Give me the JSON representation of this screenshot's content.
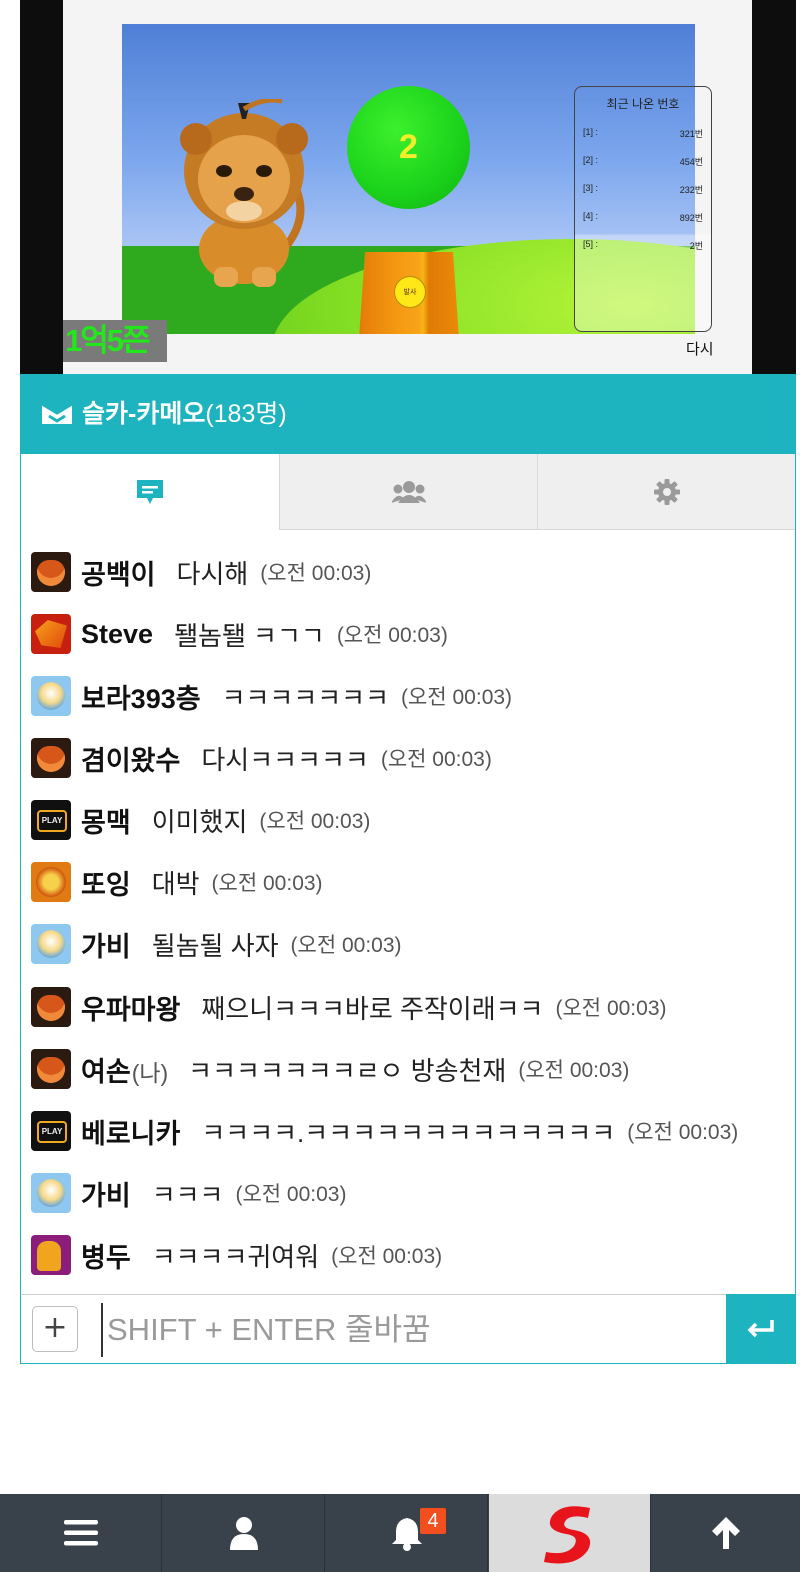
{
  "video": {
    "ball_number": "2",
    "cup_button": "발사",
    "since_label": "1억5쯘",
    "again_label": "다시",
    "recent": {
      "title": "최근 나온 번호",
      "rows": [
        {
          "key": "[1] :",
          "value": "321번"
        },
        {
          "key": "[2] :",
          "value": "454번"
        },
        {
          "key": "[3] :",
          "value": "232번"
        },
        {
          "key": "[4] :",
          "value": "892번"
        },
        {
          "key": "[5] :",
          "value": "2번"
        }
      ]
    }
  },
  "chat": {
    "title": "슬카-카메오",
    "count": "(183명)",
    "tabs": [
      {
        "name": "chat",
        "icon": "chat-bubble-icon"
      },
      {
        "name": "users",
        "icon": "users-icon"
      },
      {
        "name": "settings",
        "icon": "gear-icon"
      }
    ],
    "messages": [
      {
        "nick": "공백이",
        "tag": "",
        "text": "다시해",
        "time": "(오전 00:03)",
        "avatar": "av-dog"
      },
      {
        "nick": "Steve",
        "tag": "",
        "text": "됄놈됄 ㅋㄱㄱ",
        "time": "(오전 00:03)",
        "avatar": "av-dragon"
      },
      {
        "nick": "보라393층",
        "tag": "",
        "text": "ㅋㅋㅋㅋㅋㅋㅋ",
        "time": "(오전 00:03)",
        "avatar": "av-armor"
      },
      {
        "nick": "겸이왔수",
        "tag": "",
        "text": "다시ㅋㅋㅋㅋㅋ",
        "time": "(오전 00:03)",
        "avatar": "av-dog"
      },
      {
        "nick": "몽맥",
        "tag": "",
        "text": "이미했지",
        "time": "(오전 00:03)",
        "avatar": "av-play"
      },
      {
        "nick": "또잉",
        "tag": "",
        "text": "대박",
        "time": "(오전 00:03)",
        "avatar": "av-lion"
      },
      {
        "nick": "가비",
        "tag": "",
        "text": "될놈될 사자",
        "time": "(오전 00:03)",
        "avatar": "av-armor"
      },
      {
        "nick": "우파마왕",
        "tag": "",
        "text": "째으니ㅋㅋㅋ바로 주작이래ㅋㅋ",
        "time": "(오전 00:03)",
        "avatar": "av-dog"
      },
      {
        "nick": "여손",
        "tag": "(나)",
        "text": "ㅋㅋㅋㅋㅋㅋㅋㄹㅇ 방송천재",
        "time": "(오전 00:03)",
        "avatar": "av-dog"
      },
      {
        "nick": "베로니카",
        "tag": "",
        "text": "ㅋㅋㅋㅋ.ㅋㅋㅋㅋㅋㅋㅋㅋㅋㅋㅋㅋㅋ",
        "time": "(오전 00:03)",
        "avatar": "av-play"
      },
      {
        "nick": "가비",
        "tag": "",
        "text": "ㅋㅋㅋ",
        "time": "(오전 00:03)",
        "avatar": "av-armor"
      },
      {
        "nick": "병두",
        "tag": "",
        "text": "ㅋㅋㅋㅋ귀여워",
        "time": "(오전 00:03)",
        "avatar": "av-dino"
      }
    ],
    "input": {
      "value": "",
      "placeholder": "SHIFT + ENTER 줄바꿈",
      "plus_label": "+"
    }
  },
  "bottom_nav": {
    "items": [
      "menu-icon",
      "user-icon",
      "bell-icon",
      "s-logo",
      "arrow-up-icon"
    ],
    "notification_count": "4"
  },
  "colors": {
    "accent": "#1db4c0",
    "nav_bg": "#39424b",
    "badge": "#f24e1e"
  }
}
